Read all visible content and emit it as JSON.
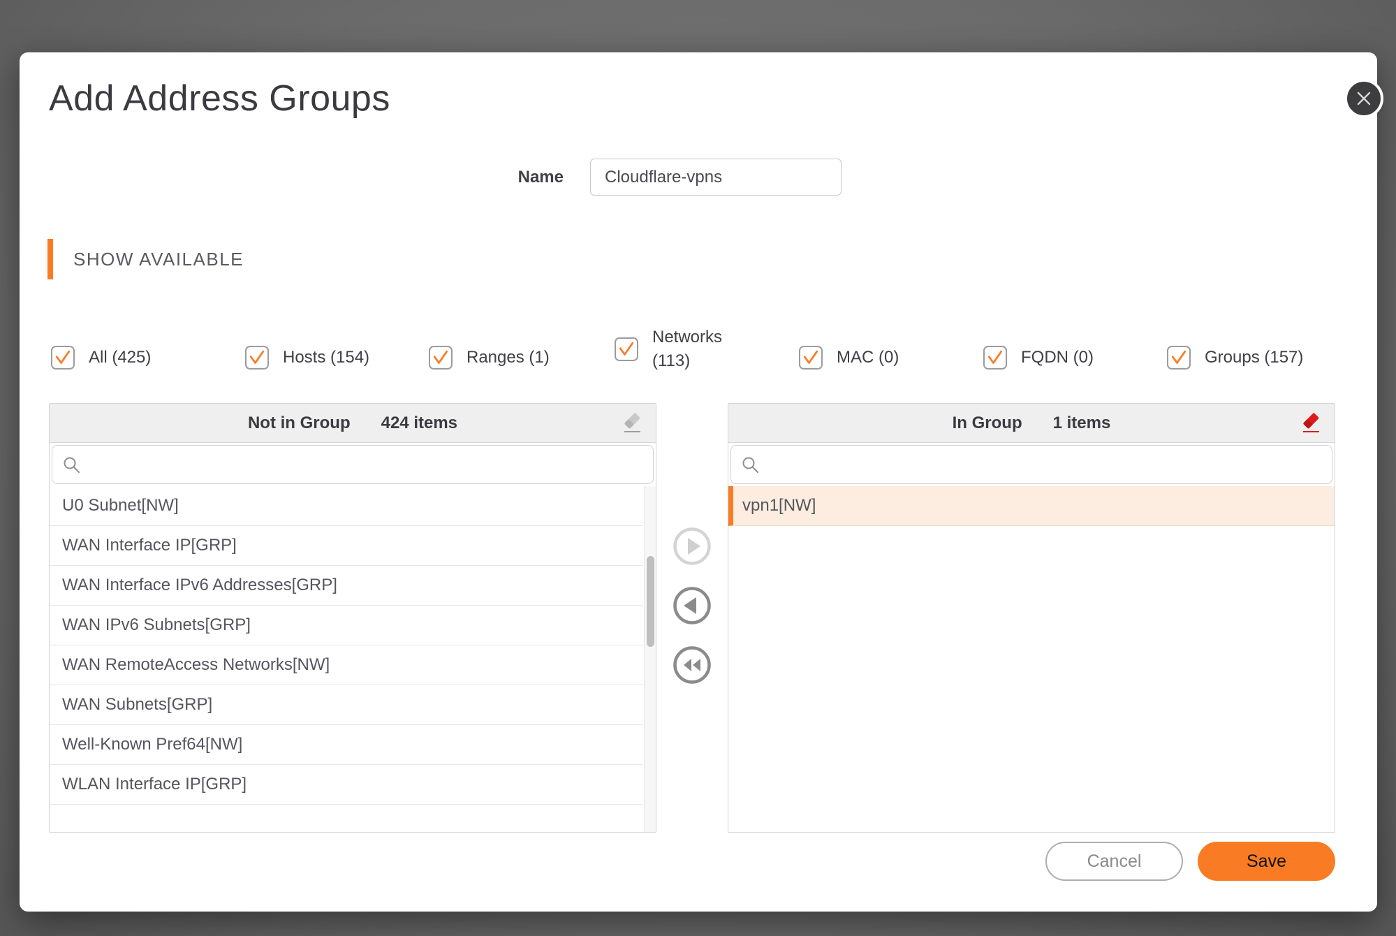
{
  "modal": {
    "title": "Add Address Groups"
  },
  "name_field": {
    "label": "Name",
    "value": "Cloudflare-vpns"
  },
  "section_header": "SHOW AVAILABLE",
  "filters": [
    {
      "label": "All (425)",
      "checked": true
    },
    {
      "label": "Hosts (154)",
      "checked": true
    },
    {
      "label": "Ranges (1)",
      "checked": true
    },
    {
      "label": "Networks (113)",
      "checked": true
    },
    {
      "label": "MAC (0)",
      "checked": true
    },
    {
      "label": "FQDN (0)",
      "checked": true
    },
    {
      "label": "Groups (157)",
      "checked": true
    }
  ],
  "left_panel": {
    "title": "Not in Group",
    "count": "424 items",
    "search_value": "",
    "items": [
      "U0 Subnet[NW]",
      "WAN Interface IP[GRP]",
      "WAN Interface IPv6 Addresses[GRP]",
      "WAN IPv6 Subnets[GRP]",
      "WAN RemoteAccess Networks[NW]",
      "WAN Subnets[GRP]",
      "Well-Known Pref64[NW]",
      "WLAN Interface IP[GRP]"
    ]
  },
  "right_panel": {
    "title": "In Group",
    "count": "1 items",
    "search_value": "",
    "items": [
      "vpn1[NW]"
    ]
  },
  "footer": {
    "cancel_label": "Cancel",
    "save_label": "Save"
  },
  "colors": {
    "accent_orange": "#F97C24",
    "eraser_red": "#DD1B1C",
    "selected_row_bg": "#FCEDE0",
    "header_gray": "#EFEFEF",
    "backdrop_gray": "#6B6B6B"
  }
}
